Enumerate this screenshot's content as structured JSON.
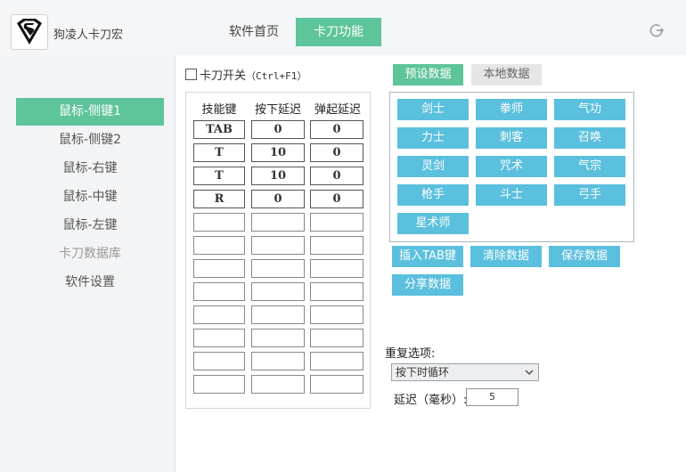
{
  "app": {
    "title": "狗凌人卡刀宏"
  },
  "header": {
    "tabs": [
      {
        "label": "软件首页"
      },
      {
        "label": "卡刀功能"
      }
    ]
  },
  "sidebar": {
    "items": [
      {
        "label": "鼠标-侧键1"
      },
      {
        "label": "鼠标-侧键2"
      },
      {
        "label": "鼠标-右键"
      },
      {
        "label": "鼠标-中键"
      },
      {
        "label": "鼠标-左键"
      },
      {
        "label": "卡刀数据库"
      },
      {
        "label": "软件设置"
      }
    ]
  },
  "switch": {
    "label": "卡刀开关",
    "hotkey": "（Ctrl+F1）",
    "checked": false
  },
  "table": {
    "headers": [
      "技能键",
      "按下延迟",
      "弹起延迟"
    ],
    "rows": [
      [
        "TAB",
        "0",
        "0"
      ],
      [
        "T",
        "10",
        "0"
      ],
      [
        "T",
        "10",
        "0"
      ],
      [
        "R",
        "0",
        "0"
      ],
      [
        "",
        "",
        ""
      ],
      [
        "",
        "",
        ""
      ],
      [
        "",
        "",
        ""
      ],
      [
        "",
        "",
        ""
      ],
      [
        "",
        "",
        ""
      ],
      [
        "",
        "",
        ""
      ],
      [
        "",
        "",
        ""
      ],
      [
        "",
        "",
        ""
      ]
    ]
  },
  "data_tabs": {
    "preset": "预设数据",
    "local": "本地数据"
  },
  "presets": [
    "剑士",
    "拳师",
    "气功",
    "力士",
    "刺客",
    "召唤",
    "灵剑",
    "咒术",
    "气宗",
    "枪手",
    "斗士",
    "弓手",
    "星术师"
  ],
  "actions": {
    "insert_tab": "插入TAB键",
    "clear": "清除数据",
    "save": "保存数据",
    "share": "分享数据"
  },
  "repeat": {
    "label": "重复选项:",
    "selected": "按下时循环",
    "delay_label": "延迟（毫秒）:",
    "delay_value": "5"
  },
  "colors": {
    "accent": "#5ec49a",
    "button": "#5bc0de"
  },
  "icons": {
    "logo": "superman-logo-icon",
    "exit": "power-exit-icon"
  }
}
